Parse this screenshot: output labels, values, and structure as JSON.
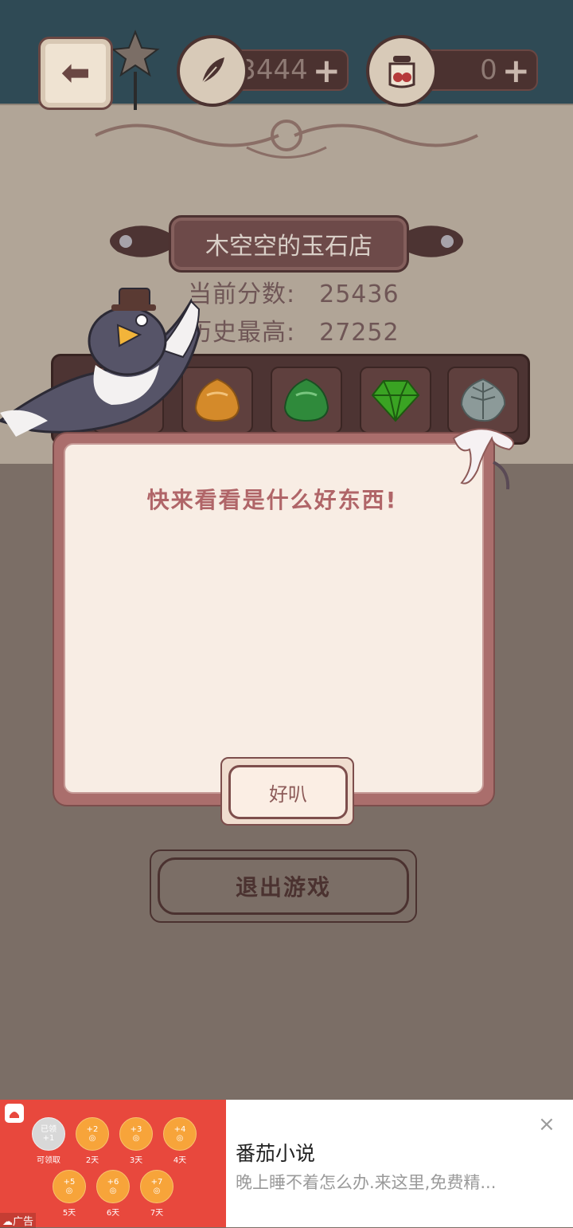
{
  "header": {
    "back_icon": "arrow-left-icon",
    "currency_1": {
      "icon": "feather-icon",
      "value": "3444",
      "plus": "+"
    },
    "currency_2": {
      "icon": "jar-icon",
      "value": "0",
      "plus": "+"
    }
  },
  "shop": {
    "title": "木空空的玉石店",
    "current_score_label": "当前分数:",
    "current_score": "25436",
    "best_score_label": "历史最高:",
    "best_score": "27252"
  },
  "jewels": [
    {
      "name": "amber-jade",
      "color": "#d48a2a"
    },
    {
      "name": "green-jade",
      "color": "#2f8a3b"
    },
    {
      "name": "emerald-gem",
      "color": "#3aa323"
    },
    {
      "name": "grey-leaf-stone",
      "color": "#8c9a99"
    }
  ],
  "dialog": {
    "message": "快来看看是什么好东西!",
    "ok_label": "好叭"
  },
  "footer": {
    "exit_label": "退出游戏"
  },
  "ad": {
    "tag": "广告",
    "title": "番茄小说",
    "description": "晚上睡不着怎么办.来这里,免费精...",
    "close": "×",
    "coins": [
      {
        "top": "已领",
        "bottom": "+1",
        "label": "可领取",
        "done": true
      },
      {
        "top": "+2",
        "bottom": "◎",
        "label": "2天"
      },
      {
        "top": "+3",
        "bottom": "◎",
        "label": "3天"
      },
      {
        "top": "+4",
        "bottom": "◎",
        "label": "4天"
      },
      {
        "top": "+5",
        "bottom": "◎",
        "label": "5天"
      },
      {
        "top": "+6",
        "bottom": "◎",
        "label": "6天"
      },
      {
        "top": "+7",
        "bottom": "◎",
        "label": "7天"
      }
    ]
  },
  "colors": {
    "dialog_border": "#aa6e6c",
    "dialog_bg": "#f8ede4",
    "ad_red": "#e8483d"
  }
}
